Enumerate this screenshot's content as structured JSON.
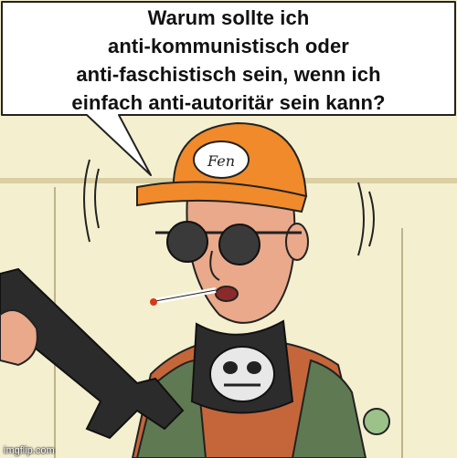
{
  "speech_bubble": {
    "lines": [
      "Warum sollte ich",
      "anti-kommunistisch oder",
      "anti-faschistisch sein, wenn ich",
      "einfach anti-autoritär sein kann?"
    ]
  },
  "cap_patch_text": "Fen",
  "watermark": "imgflip.com",
  "colors": {
    "background": "#f4efcf",
    "cap": "#f08a2a",
    "skin": "#e9a98a",
    "vest": "#5f7a52",
    "shirt": "#c4663a",
    "rifle": "#2b2b2b"
  }
}
